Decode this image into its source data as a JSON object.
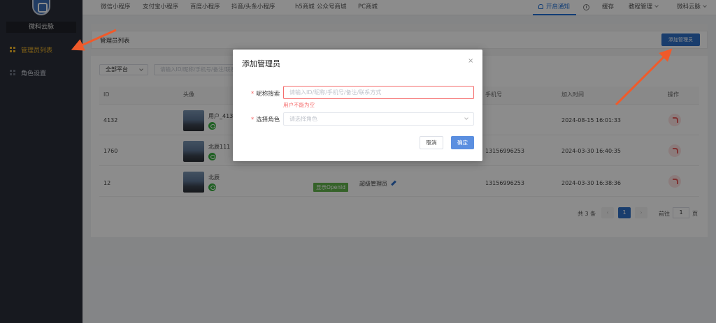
{
  "sidebar": {
    "brand": "微科云脉",
    "items": [
      {
        "label": "管理员列表",
        "active": true
      },
      {
        "label": "角色设置",
        "active": false
      }
    ]
  },
  "topbar": {
    "tabs": [
      "微信小程序",
      "支付宝小程序",
      "百度小程序",
      "抖音/头条小程序",
      "h5商城",
      "公众号商城",
      "PC商城"
    ],
    "notify": "开启通知",
    "cache": "缓存",
    "tutorial": "教程管理",
    "user": "微科云脉"
  },
  "page": {
    "title": "管理员列表",
    "add_button": "添加管理员"
  },
  "filters": {
    "platform": "全部平台",
    "search_placeholder": "请输入ID/昵称/手机号/备注/联系方式"
  },
  "table": {
    "columns": [
      "ID",
      "头像",
      "手机号",
      "加入时间",
      "操作"
    ],
    "rows": [
      {
        "id": "4132",
        "name": "用户_4132",
        "phone": "",
        "joined": "2024-08-15 16:01:33"
      },
      {
        "id": "1760",
        "name": "北辰111",
        "phone": "13156996253",
        "joined": "2024-03-30 16:40:35"
      },
      {
        "id": "12",
        "name": "北辰",
        "role": "超级管理员",
        "phone": "13156996253",
        "joined": "2024-03-30 16:38:36",
        "openid_tag": "显示OpenId"
      }
    ]
  },
  "pager": {
    "total": "共 3 条",
    "current": "1",
    "goto_label": "前往",
    "goto_value": "1",
    "goto_unit": "页"
  },
  "modal": {
    "title": "添加管理员",
    "close": "×",
    "nickname_label": "昵称搜索",
    "nickname_placeholder": "请输入ID/昵称/手机号/备注/联系方式",
    "nickname_error": "用户不能为空",
    "role_label": "选择角色",
    "role_placeholder": "请选择角色",
    "cancel": "取消",
    "confirm": "确定"
  },
  "colors": {
    "sidebar_bg": "#2b2f3a",
    "active": "#f0b429",
    "primary": "#2e6fc7",
    "error": "#f56c6c",
    "annotation_arrow": "#f05a2a"
  }
}
